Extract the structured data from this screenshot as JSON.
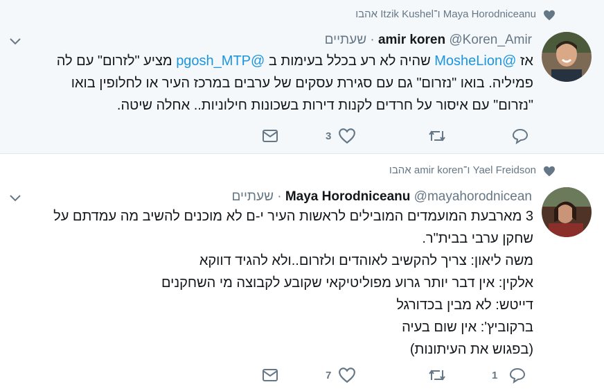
{
  "tweets": [
    {
      "liked_by": "Maya Horodniceanu ו־Itzik Kushel אהבו",
      "name": "amir koren",
      "handle": "@Koren_Amir",
      "sep": "·",
      "time": "שעתיים",
      "line1_a": "אז ",
      "line1_mention1": "@MosheLion",
      "line1_b": " שהיה לא רע בכלל בעימות  ב ",
      "line1_mention2": "@pgosh_MTP",
      "line1_c": "  מציע \"לזרום\" עם לה",
      "line2": "פמיליה. בואו \"נזרום\" גם עם סגירת עסקים של ערבים במרכז העיר או לחלופין בואו",
      "line3": "\"נזרום\" עם איסור על חרדים לקנות דירות בשכונות חילוניות.. אחלה שיטה.",
      "like_count": "3",
      "reply_count": "",
      "avatar_bg": "#6b5a48"
    },
    {
      "liked_by": "Yael Freidson ו־amir koren אהבו",
      "name": "Maya Horodniceanu",
      "handle": "@mayahorodnicean",
      "sep": "·",
      "time": "שעתיים",
      "lines": [
        "3 מארבעת המועמדים המובילים לראשות העיר י-ם לא מוכנים להשיב מה עמדתם על",
        "שחקן ערבי בבית\"ר.",
        "משה ליאון: צריך להקשיב לאוהדים ולזרום..ולא להגיד דווקא",
        "אלקין: אין דבר יותר גרוע מפוליטיקאי שקובע לקבוצה מי השחקנים",
        "דייטש: לא מבין בכדורגל",
        "ברקוביץ': אין שום בעיה",
        "(בפגוש את העיתונות)"
      ],
      "like_count": "7",
      "reply_count": "1",
      "avatar_bg": "#5a3a2e"
    }
  ],
  "colors": {
    "accent": "#1b95e0",
    "muted": "#657786",
    "bg_highlight": "#f5f8fa"
  },
  "icons": [
    "heart-icon",
    "chevron-down-icon",
    "reply-icon",
    "retweet-icon",
    "like-icon",
    "message-icon"
  ]
}
